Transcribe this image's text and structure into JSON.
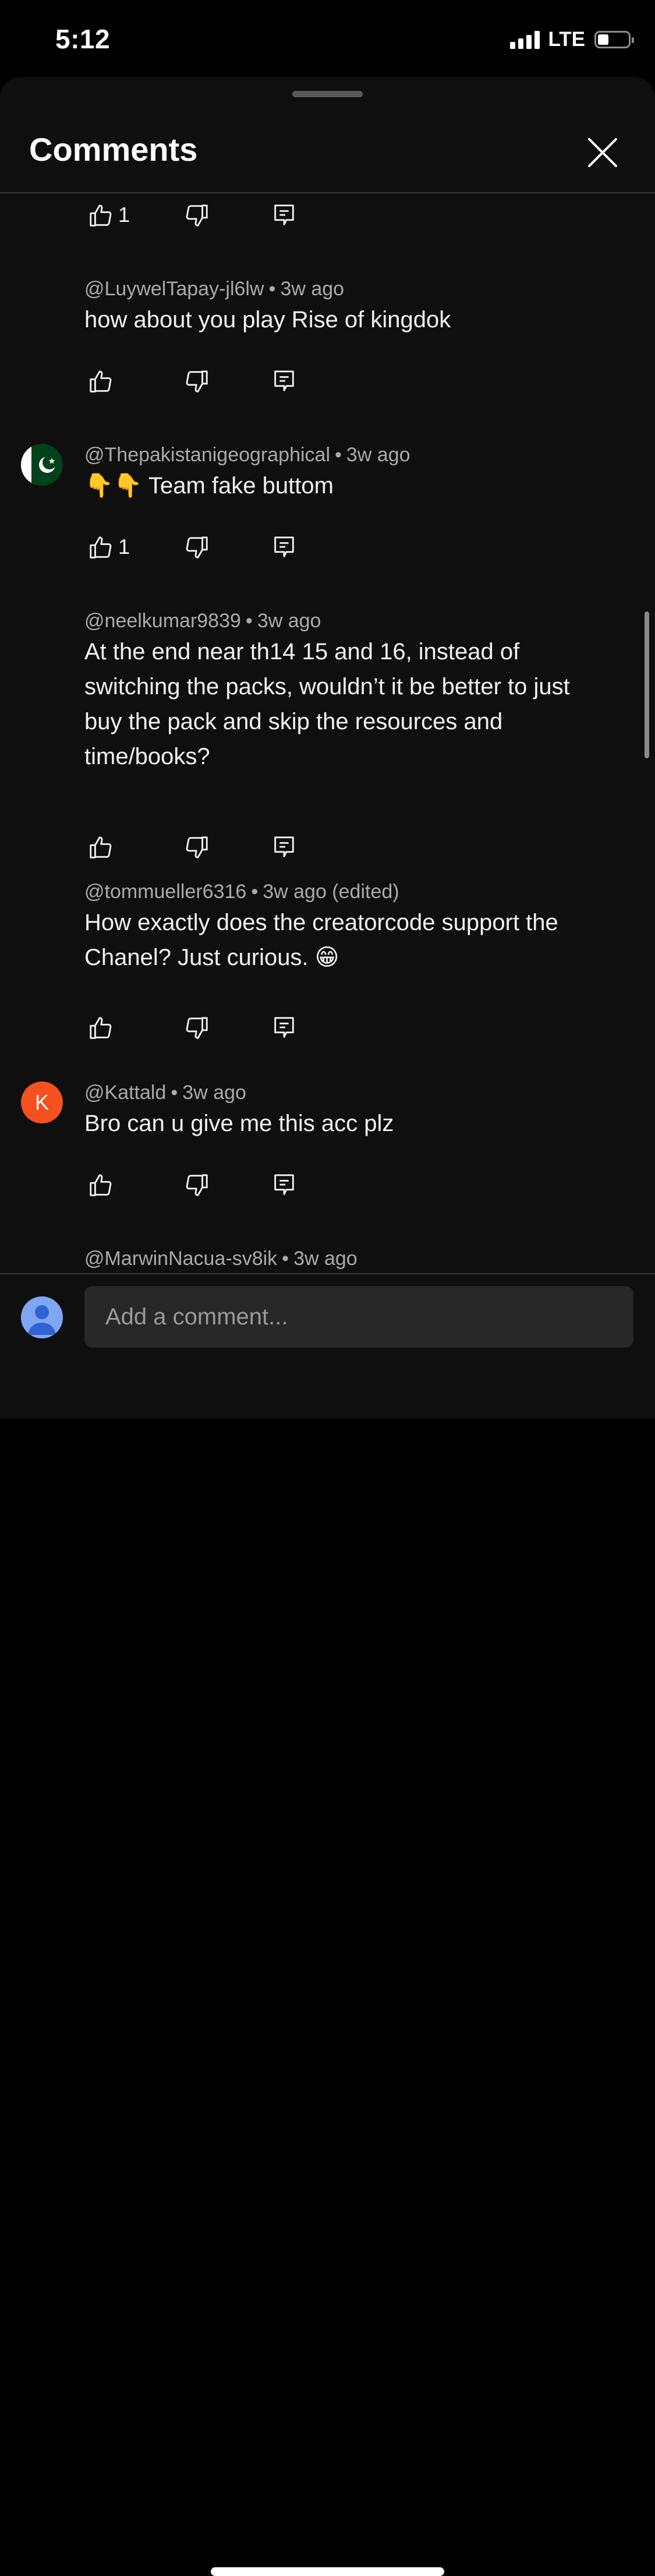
{
  "status_bar": {
    "time": "5:12",
    "network": "LTE"
  },
  "header": {
    "title": "Comments",
    "close_icon": "close-icon"
  },
  "comments": [
    {
      "author": "",
      "age": "",
      "text": "",
      "likes": "1"
    },
    {
      "author": "@LuywelTapay-jl6lw",
      "age": "3w ago",
      "text": "how about you play Rise of kingdok",
      "likes": ""
    },
    {
      "author": "@Thepakistanigeographical",
      "age": "3w ago",
      "text": "Team fake buttom",
      "text_prefix_emoji": "👇👇",
      "likes": "1",
      "avatar": "pakistan-flag"
    },
    {
      "author": "@neelkumar9839",
      "age": "3w ago",
      "text": "At the end near th14 15 and 16, instead of switching the packs, wouldn’t it be better to just buy the pack and skip the resources and time/books?",
      "likes": ""
    },
    {
      "author": "@tommueller6316",
      "age": "3w ago (edited)",
      "text": "How exactly does the creatorcode support the Chanel? Just curious.",
      "text_suffix_emoji": "😁",
      "likes": ""
    },
    {
      "author": "@Kattald",
      "age": "3w ago",
      "text": "Bro can u give me this acc plz",
      "likes": "",
      "avatar_letter": "K",
      "avatar_color": "#f4511e"
    },
    {
      "author": "@MarwinNacua-sv8ik",
      "age": "3w ago",
      "text": "",
      "likes": ""
    }
  ],
  "composer": {
    "placeholder": "Add a comment..."
  },
  "colors": {
    "sheet_bg": "#0f0f0f",
    "meta_text": "#aaaaaa",
    "input_bg": "#272727",
    "k_avatar": "#f4511e"
  }
}
